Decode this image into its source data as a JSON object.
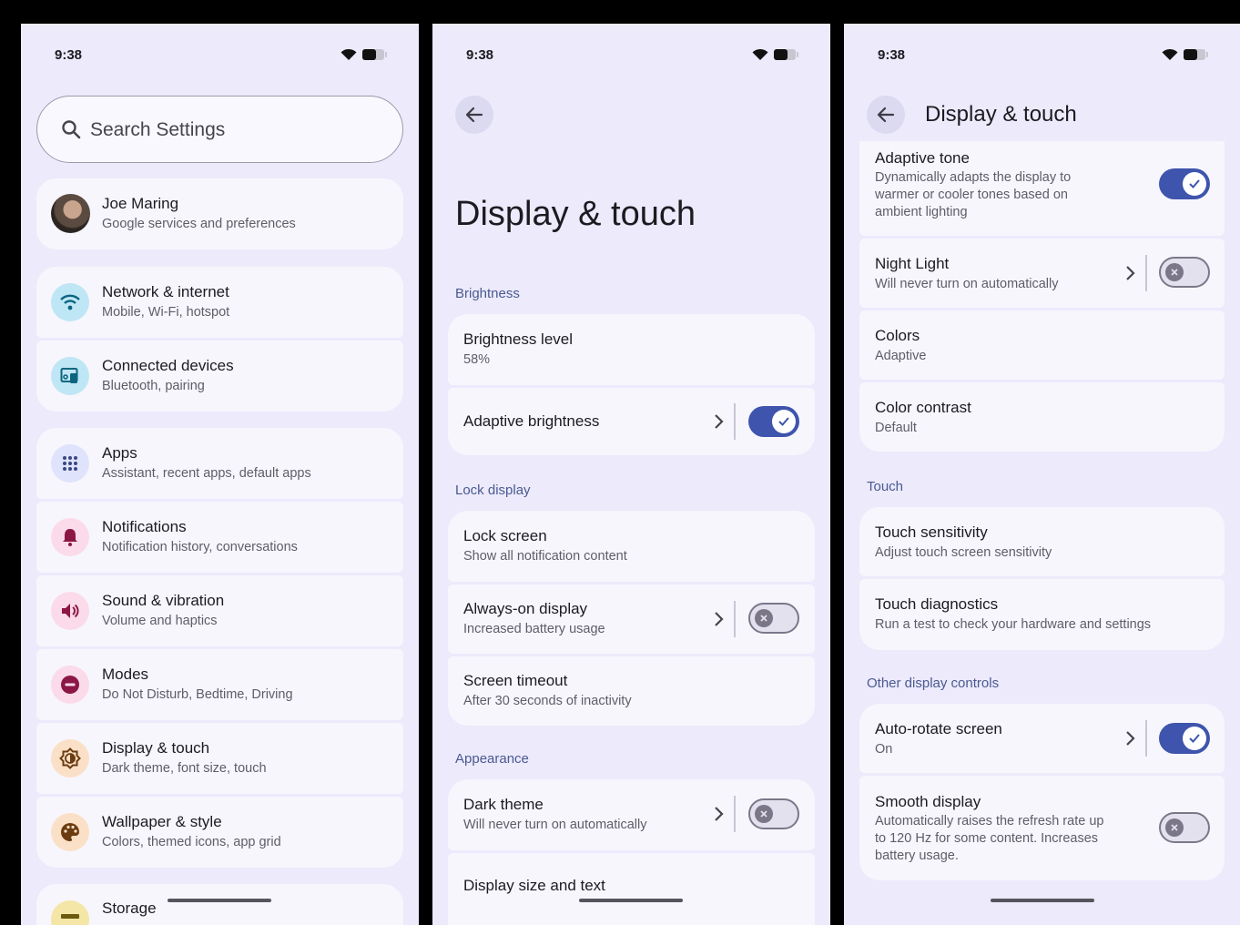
{
  "status": {
    "time": "9:38"
  },
  "screen1": {
    "search_placeholder": "Search Settings",
    "profile": {
      "name": "Joe Maring",
      "sub": "Google services and preferences"
    },
    "items": [
      {
        "title": "Network & internet",
        "sub": "Mobile, Wi-Fi, hotspot",
        "icon": "wifi-icon",
        "color": "#bfe6f5"
      },
      {
        "title": "Connected devices",
        "sub": "Bluetooth, pairing",
        "icon": "devices-icon",
        "color": "#bfe6f5"
      },
      {
        "title": "Apps",
        "sub": "Assistant, recent apps, default apps",
        "icon": "apps-grid-icon",
        "color": "#dfe3fb"
      },
      {
        "title": "Notifications",
        "sub": "Notification history, conversations",
        "icon": "bell-icon",
        "color": "#fbdbe9"
      },
      {
        "title": "Sound & vibration",
        "sub": "Volume and haptics",
        "icon": "volume-icon",
        "color": "#fbdbe9"
      },
      {
        "title": "Modes",
        "sub": "Do Not Disturb, Bedtime, Driving",
        "icon": "do-not-disturb-icon",
        "color": "#fbdbe9"
      },
      {
        "title": "Display & touch",
        "sub": "Dark theme, font size, touch",
        "icon": "brightness-icon",
        "color": "#fbe0c8"
      },
      {
        "title": "Wallpaper & style",
        "sub": "Colors, themed icons, app grid",
        "icon": "palette-icon",
        "color": "#fbe0c8"
      },
      {
        "title": "Storage",
        "sub": "",
        "icon": "storage-icon",
        "color": "#f4e6a6"
      }
    ]
  },
  "screen2": {
    "title": "Display & touch",
    "sections": {
      "brightness": "Brightness",
      "lock": "Lock display",
      "appearance": "Appearance"
    },
    "brightness_level": {
      "title": "Brightness level",
      "value": "58%"
    },
    "adaptive_brightness": {
      "title": "Adaptive brightness",
      "on": true
    },
    "lock_screen": {
      "title": "Lock screen",
      "sub": "Show all notification content"
    },
    "always_on": {
      "title": "Always-on display",
      "sub": "Increased battery usage",
      "on": false
    },
    "screen_timeout": {
      "title": "Screen timeout",
      "sub": "After 30 seconds of inactivity"
    },
    "dark_theme": {
      "title": "Dark theme",
      "sub": "Will never turn on automatically",
      "on": false
    },
    "display_size": {
      "title": "Display size and text"
    }
  },
  "screen3": {
    "title": "Display & touch",
    "adaptive_tone": {
      "title": "Adaptive tone",
      "sub_lines": [
        "Dynamically adapts the display to",
        "warmer or cooler tones based on",
        "ambient lighting"
      ],
      "on": true
    },
    "night_light": {
      "title": "Night Light",
      "sub": "Will never turn on automatically",
      "on": false
    },
    "colors": {
      "title": "Colors",
      "sub": "Adaptive"
    },
    "color_contrast": {
      "title": "Color contrast",
      "sub": "Default"
    },
    "sections": {
      "touch": "Touch",
      "other": "Other display controls"
    },
    "touch_sensitivity": {
      "title": "Touch sensitivity",
      "sub": "Adjust touch screen sensitivity"
    },
    "touch_diagnostics": {
      "title": "Touch diagnostics",
      "sub": "Run a test to check your hardware and settings"
    },
    "auto_rotate": {
      "title": "Auto-rotate screen",
      "sub": "On",
      "on": true
    },
    "smooth_display": {
      "title": "Smooth display",
      "sub_lines": [
        "Automatically raises the refresh rate up",
        "to 120 Hz for some content. Increases",
        "battery usage."
      ],
      "on": false
    }
  },
  "colors": {
    "accent": "#3e54ad",
    "panel_bg": "#eceafb",
    "card_bg": "#f7f6fd",
    "section": "#4a5a90"
  }
}
